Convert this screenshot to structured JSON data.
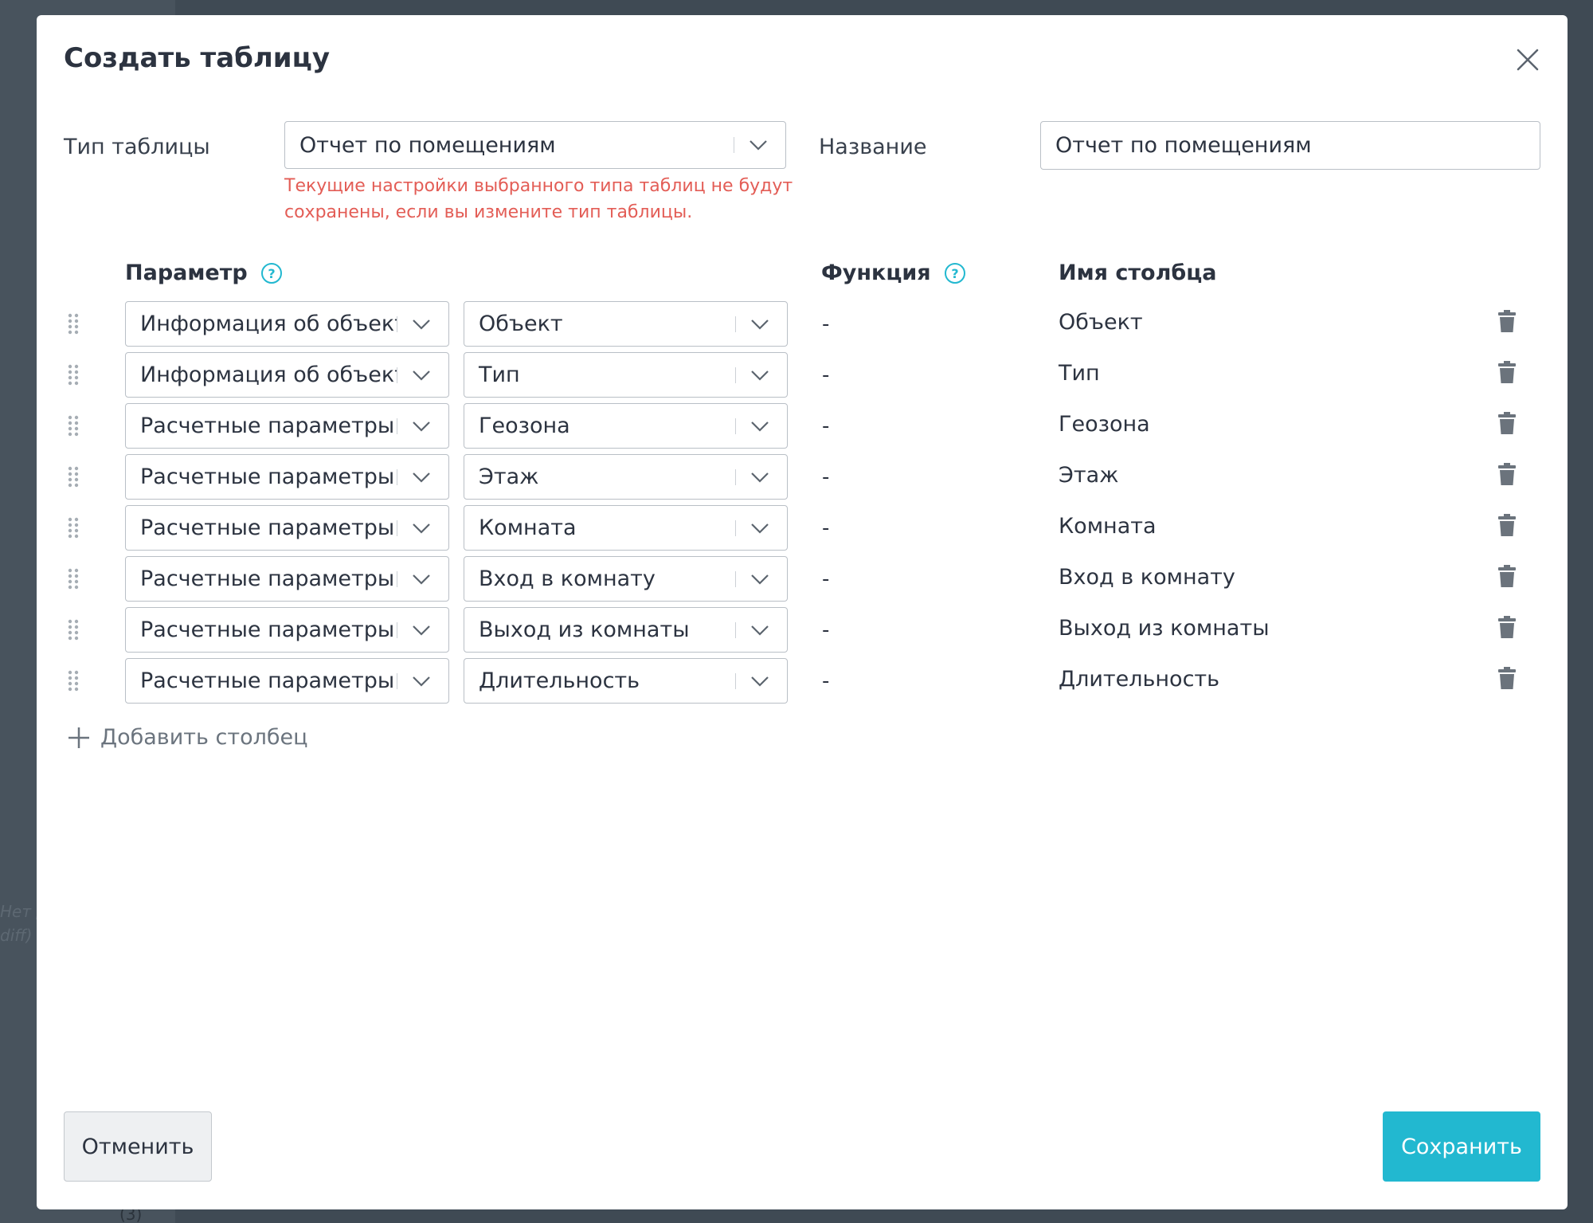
{
  "background": {
    "hint_line_1": "Нет д",
    "hint_line_2": "diff) .",
    "count": "(3)"
  },
  "modal": {
    "title": "Создать таблицу",
    "close_icon": "close-icon"
  },
  "form": {
    "type_label": "Тип таблицы",
    "type_value": "Отчет по помещениям",
    "name_label": "Название",
    "name_value": "Отчет по помещениям",
    "warning": "Текущие настройки выбранного типа таблиц не будут сохранены, если вы измените тип таблицы."
  },
  "columns_header": {
    "parameter": "Параметр",
    "function": "Функция",
    "column_name": "Имя столбца"
  },
  "rows": [
    {
      "group": "Информация об объект",
      "param": "Объект",
      "function": "-",
      "name": "Объект"
    },
    {
      "group": "Информация об объект",
      "param": "Тип",
      "function": "-",
      "name": "Тип"
    },
    {
      "group": "Расчетные параметры",
      "param": "Геозона",
      "function": "-",
      "name": "Геозона"
    },
    {
      "group": "Расчетные параметры",
      "param": "Этаж",
      "function": "-",
      "name": "Этаж"
    },
    {
      "group": "Расчетные параметры",
      "param": "Комната",
      "function": "-",
      "name": "Комната"
    },
    {
      "group": "Расчетные параметры",
      "param": "Вход в комнату",
      "function": "-",
      "name": "Вход в комнату"
    },
    {
      "group": "Расчетные параметры",
      "param": "Выход из комнаты",
      "function": "-",
      "name": "Выход из комнаты"
    },
    {
      "group": "Расчетные параметры",
      "param": "Длительность",
      "function": "-",
      "name": "Длительность"
    }
  ],
  "add_column": "Добавить столбец",
  "buttons": {
    "cancel": "Отменить",
    "save": "Сохранить"
  },
  "colors": {
    "primary": "#22b8d0",
    "warning": "#e35d56",
    "help": "#22b8d0"
  }
}
